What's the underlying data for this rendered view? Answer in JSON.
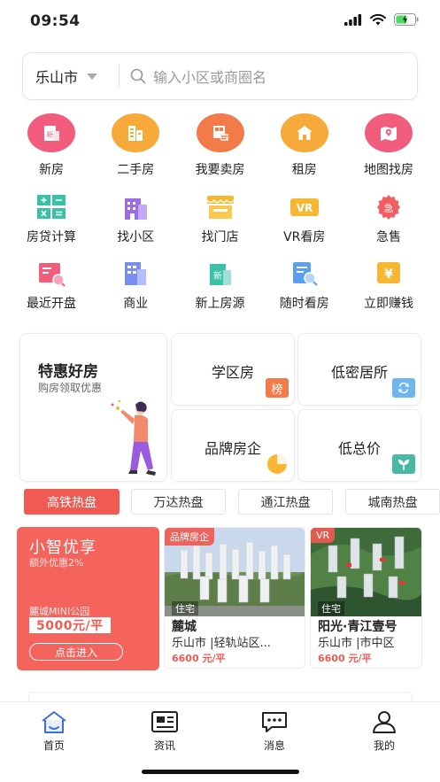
{
  "status": {
    "time": "09:54"
  },
  "search": {
    "city": "乐山市",
    "placeholder": "输入小区或商圈名"
  },
  "main_icons": [
    {
      "label": "新房",
      "icon": "new-house-icon",
      "color": "#f25d7e"
    },
    {
      "label": "二手房",
      "icon": "second-hand-house-icon",
      "color": "#f7a93a"
    },
    {
      "label": "我要卖房",
      "icon": "sell-house-icon",
      "color": "#f37b4a"
    },
    {
      "label": "租房",
      "icon": "rent-house-icon",
      "color": "#f7a93a"
    },
    {
      "label": "地图找房",
      "icon": "map-search-icon",
      "color": "#f25d7e"
    }
  ],
  "tool_icons_row1": [
    {
      "label": "房贷计算",
      "icon": "calculator-icon"
    },
    {
      "label": "找小区",
      "icon": "community-icon"
    },
    {
      "label": "找门店",
      "icon": "store-icon"
    },
    {
      "label": "VR看房",
      "icon": "vr-icon",
      "text": "VR"
    },
    {
      "label": "急售",
      "icon": "urgent-sale-icon",
      "text": "急"
    }
  ],
  "tool_icons_row2": [
    {
      "label": "最近开盘",
      "icon": "recent-opening-icon"
    },
    {
      "label": "商业",
      "icon": "commercial-icon"
    },
    {
      "label": "新上房源",
      "icon": "new-listing-icon",
      "text": "新"
    },
    {
      "label": "随时看房",
      "icon": "view-anytime-icon"
    },
    {
      "label": "立即赚钱",
      "icon": "earn-money-icon",
      "text": "¥"
    }
  ],
  "promo": {
    "main_title": "特惠好房",
    "main_sub": "购房领取优惠",
    "cards": [
      {
        "title": "学区房",
        "badge": "榜",
        "badge_color": "#f37b4a",
        "icon": "ranking-icon"
      },
      {
        "title": "低密居所",
        "badge": "",
        "badge_color": "#6fb6ee",
        "icon": "low-density-icon"
      },
      {
        "title": "品牌房企",
        "badge": "",
        "badge_color": "#f7b733",
        "icon": "brand-pie-icon"
      },
      {
        "title": "低总价",
        "badge": "",
        "badge_color": "#49b9a6",
        "icon": "low-price-icon"
      }
    ]
  },
  "tabs": [
    "高铁热盘",
    "万达热盘",
    "通江热盘",
    "城南热盘"
  ],
  "featured": {
    "title": "小智优享",
    "sub": "额外优惠2%",
    "name": "麓城MINI公园",
    "price": "5000元/平",
    "button": "点击进入"
  },
  "listings": [
    {
      "tag": "品牌房企",
      "type": "住宅",
      "name": "麓城",
      "location": "乐山市 |轻轨站区...",
      "price": "6600 元/平"
    },
    {
      "tag": "VR",
      "type": "住宅",
      "name": "阳光·青江壹号",
      "location": "乐山市 |市中区",
      "price": "6600 元/平"
    }
  ],
  "nav": [
    {
      "label": "首页",
      "icon": "home-icon",
      "active": true
    },
    {
      "label": "资讯",
      "icon": "news-icon"
    },
    {
      "label": "消息",
      "icon": "message-icon"
    },
    {
      "label": "我的",
      "icon": "profile-icon"
    }
  ],
  "colors": {
    "accent": "#f05a52",
    "home_active": "#3b6fd8"
  }
}
